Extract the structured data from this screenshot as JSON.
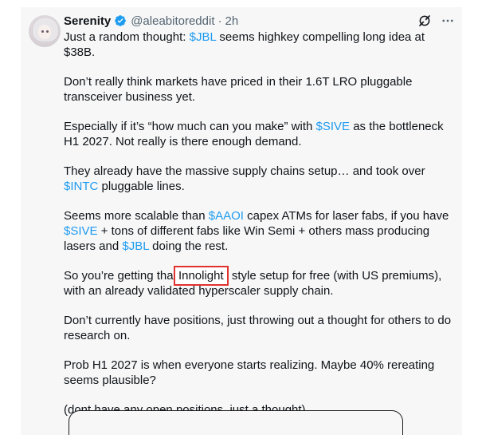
{
  "author": {
    "display_name": "Serenity",
    "handle": "@aleabitoreddit",
    "separator": "·",
    "time": "2h"
  },
  "icons": {
    "verified": "verified-badge-icon",
    "grok": "grok-icon",
    "more": "more-options-icon",
    "avatar": "avatar"
  },
  "colors": {
    "cashtag": "#1d9bf0",
    "verified": "#1d9bf0",
    "highlight_border": "#e0322e",
    "text": "#0f1419",
    "secondary_text": "#536471",
    "card_background": "#f7f7f7"
  },
  "tweet": {
    "p1": {
      "t1": "Just a random thought: ",
      "tag1": "$JBL",
      "t2": " seems highkey compelling long idea at $38B."
    },
    "p2": {
      "t1": "Don’t really think markets have priced in their 1.6T LRO pluggable transceiver business yet."
    },
    "p3": {
      "t1": "Especially if it’s “how much can you make” with ",
      "tag1": "$SIVE",
      "t2": " as the bottleneck H1 2027. Not really is there enough demand."
    },
    "p4": {
      "t1": "They already have the massive supply chains setup… and took over ",
      "tag1": "$INTC",
      "t2": " pluggable lines."
    },
    "p5": {
      "t1": "Seems more scalable than ",
      "tag1": "$AAOI",
      "t2": " capex ATMs for laser fabs, if you have ",
      "tag2": "$SIVE",
      "t3": " + tons of different fabs like Win Semi + others mass producing lasers and ",
      "tag3": "$JBL",
      "t4": " doing the rest."
    },
    "p6": {
      "t1": "So you’re getting that ",
      "highlight": "Innolight",
      "t2": " style setup for free (with US premiums), with an already validated hyperscaler supply chain."
    },
    "p7": {
      "t1": "Don’t currently have positions, just throwing out a thought for others to do research on."
    },
    "p8": {
      "t1": "Prob H1 2027 is when everyone starts realizing. Maybe 40% rereating seems plausible?"
    },
    "p9": {
      "t1": "(dont have any open positions, just a thought)"
    }
  }
}
